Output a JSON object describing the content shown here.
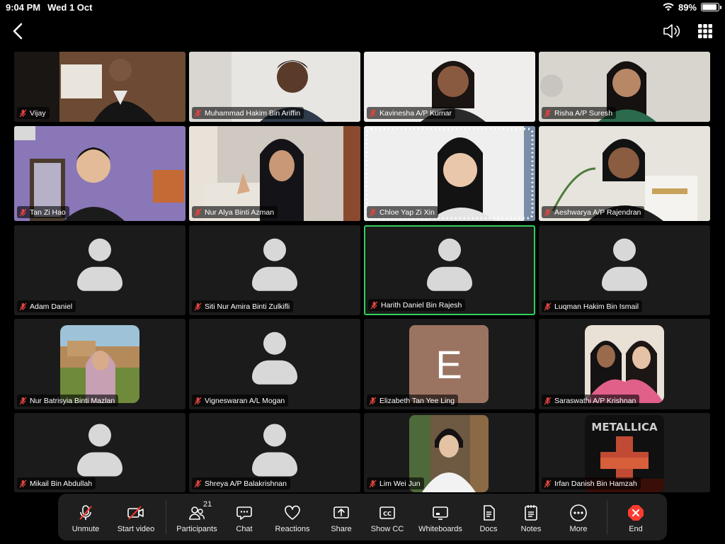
{
  "status": {
    "time": "9:04 PM",
    "date": "Wed 1 Oct",
    "battery": "89%",
    "battery_level": 0.89
  },
  "icons": {
    "back": "chevron-left-icon",
    "speaker": "speaker-icon",
    "gallery": "grid-view-icon",
    "muted_mic": "mic-muted-icon"
  },
  "colors": {
    "active_speaker_border": "#2fd15d",
    "end_red": "#ff3b30",
    "muted_red": "#e0443e",
    "toolbar_bg": "#1f1f1f"
  },
  "participants": [
    {
      "name": "Vijay"
    },
    {
      "name": "Muhammad Hakim Bin Ariffin"
    },
    {
      "name": "Kavinesha A/P Kumar"
    },
    {
      "name": "Risha A/P Suresh"
    },
    {
      "name": "Tan Zi Hao"
    },
    {
      "name": "Nur Alya Binti Azman"
    },
    {
      "name": "Chloe Yap Zi Xin"
    },
    {
      "name": "Aeshwarya A/P Rajendran"
    },
    {
      "name": "Adam Daniel"
    },
    {
      "name": "Siti Nur Amira Binti Zulkifli"
    },
    {
      "name": "Harith Daniel Bin Rajesh"
    },
    {
      "name": "Luqman Hakim Bin Ismail"
    },
    {
      "name": "Nur Batrisyia Binti Mazlan"
    },
    {
      "name": "Vigneswaran A/L Mogan"
    },
    {
      "name": "Elizabeth Tan Yee Ling",
      "avatar_letter": "E"
    },
    {
      "name": "Saraswathi A/P Krishnan"
    },
    {
      "name": "Mikail Bin Abdullah"
    },
    {
      "name": "Shreya A/P Balakrishnan"
    },
    {
      "name": "Lim Wei Jun"
    },
    {
      "name": "Irfan Danish Bin Hamzah",
      "avatar_logo_text": "METALLICA"
    }
  ],
  "toolbar": {
    "unmute": "Unmute",
    "start_video": "Start video",
    "participants": "Participants",
    "participants_count": "21",
    "chat": "Chat",
    "reactions": "Reactions",
    "share": "Share",
    "show_cc": "Show CC",
    "whiteboards": "Whiteboards",
    "docs": "Docs",
    "notes": "Notes",
    "more": "More",
    "end": "End"
  }
}
